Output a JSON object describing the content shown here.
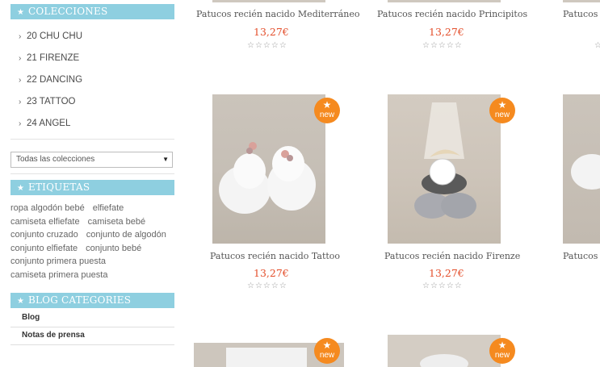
{
  "sidebar": {
    "collections_title": "COLECCIONES",
    "collections": [
      {
        "label": "20 CHU CHU"
      },
      {
        "label": "21 FIRENZE"
      },
      {
        "label": "22 DANCING"
      },
      {
        "label": "23 TATTOO"
      },
      {
        "label": "24 ANGEL"
      }
    ],
    "select": {
      "value": "Todas las colecciones"
    },
    "tags_title": "ETIQUETAS",
    "tags": [
      "ropa algodón bebé",
      "elfiefate",
      "camiseta elfiefate",
      "camiseta bebé",
      "conjunto cruzado",
      "conjunto de algodón",
      "conjunto elfiefate",
      "conjunto bebé",
      "conjunto primera puesta",
      "camiseta primera puesta"
    ],
    "blog_title": "BLOG CATEGORIES",
    "blog": [
      {
        "label": "Blog"
      },
      {
        "label": "Notas de prensa"
      }
    ]
  },
  "products": {
    "top": [
      {
        "name": "Patucos recién nacido Mediterráneo",
        "price": "13,27€",
        "rating": "☆☆☆☆☆"
      },
      {
        "name": "Patucos recién nacido Principitos",
        "price": "13,27€",
        "rating": "☆☆☆☆☆"
      },
      {
        "name": "Patucos",
        "price": "",
        "rating": "☆☆"
      }
    ],
    "middle": [
      {
        "name": "Patucos recién nacido Tattoo",
        "price": "13,27€",
        "rating": "☆☆☆☆☆",
        "badge": "new"
      },
      {
        "name": "Patucos recién nacido Firenze",
        "price": "13,27€",
        "rating": "☆☆☆☆☆",
        "badge": "new"
      },
      {
        "name": "Patucos",
        "price": "",
        "rating": ""
      }
    ],
    "bottom": [
      {
        "badge": "new"
      },
      {
        "badge": "new"
      }
    ]
  },
  "colors": {
    "accent": "#8ecfe0",
    "price": "#e4502d",
    "badge": "#f58a1f"
  },
  "icons": {
    "title_icon": "star-icon",
    "collection_bullet": "chevron-right-icon",
    "badge_icon": "star-icon"
  }
}
